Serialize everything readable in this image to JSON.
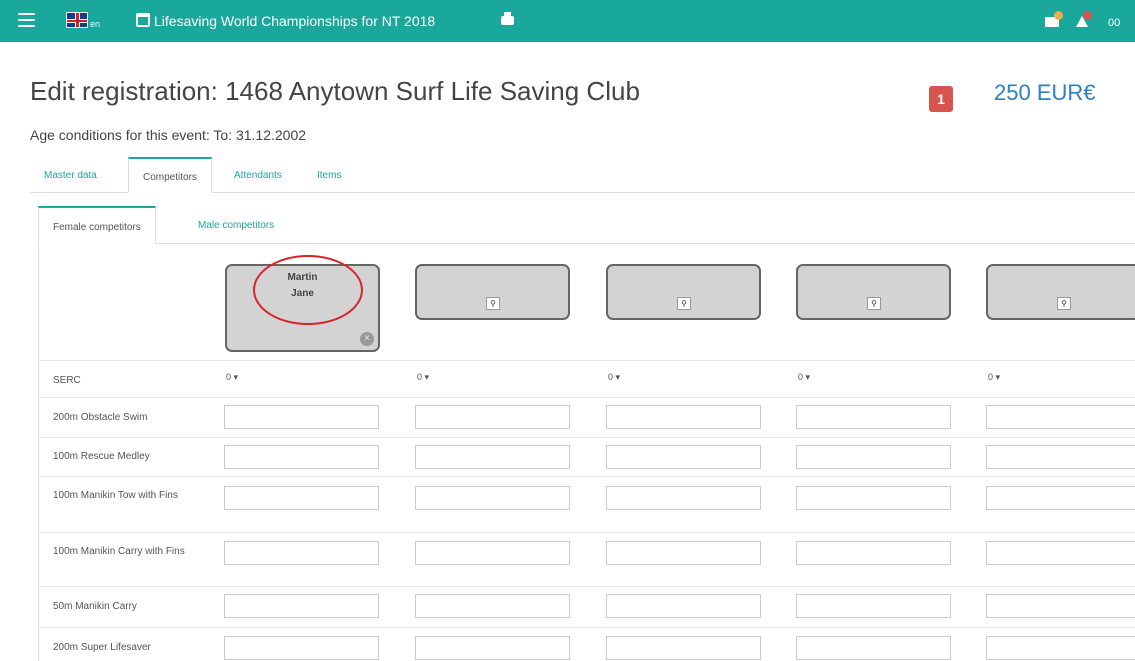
{
  "topbar": {
    "lang": "en",
    "event_title": "Lifesaving World Championships for NT 2018",
    "mail_badge_color": "#f0ad4e",
    "bell_badge_color": "#d9534f",
    "more_text": "00"
  },
  "header": {
    "title": "Edit registration: 1468 Anytown Surf Life Saving Club",
    "count_badge": "1",
    "price": "250 EUR€",
    "age_conditions": "Age conditions for this event: To: 31.12.2002"
  },
  "tabs": [
    "Master data",
    "Competitors",
    "Attendants",
    "Items"
  ],
  "subtabs": [
    "Female competitors",
    "Male competitors"
  ],
  "competitors": [
    {
      "last": "Martin",
      "first": "Jane",
      "filled": true
    },
    {
      "last": "",
      "first": "",
      "filled": false
    },
    {
      "last": "",
      "first": "",
      "filled": false
    },
    {
      "last": "",
      "first": "",
      "filled": false
    },
    {
      "last": "",
      "first": "",
      "filled": false
    }
  ],
  "serc": {
    "label": "SERC",
    "value": "0 ▾"
  },
  "events": [
    "200m Obstacle Swim",
    "100m Rescue Medley",
    "100m Manikin Tow with Fins",
    "100m Manikin Carry with Fins",
    "50m Manikin Carry",
    "200m Super Lifesaver"
  ],
  "colors": {
    "accent": "#1aa79c",
    "price": "#2a82c4",
    "badge": "#d9534f",
    "highlight": "#d8232a"
  }
}
